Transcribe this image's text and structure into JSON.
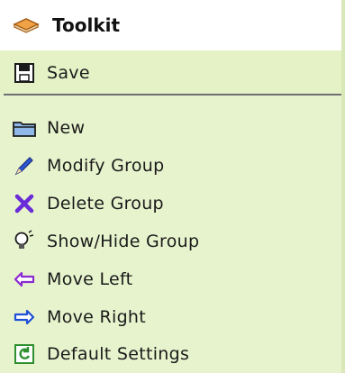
{
  "header": {
    "title": "Toolkit",
    "icon": "book-icon"
  },
  "items_top": [
    {
      "label": "Save",
      "icon": "floppy-disk-icon"
    }
  ],
  "items": [
    {
      "label": "New",
      "icon": "folder-icon"
    },
    {
      "label": "Modify Group",
      "icon": "pencil-icon"
    },
    {
      "label": "Delete Group",
      "icon": "delete-x-icon"
    },
    {
      "label": "Show/Hide Group",
      "icon": "lightbulb-icon"
    },
    {
      "label": "Move Left",
      "icon": "arrow-left-icon"
    },
    {
      "label": "Move Right",
      "icon": "arrow-right-icon"
    },
    {
      "label": "Default Settings",
      "icon": "refresh-icon"
    }
  ],
  "colors": {
    "panel_bg": "#e7f3cd",
    "header_bg": "#ffffff",
    "divider": "#6f6f6f",
    "delete_icon": "#6a2bd8",
    "arrow_left_icon": "#8b2ad0",
    "arrow_right_icon": "#1f4fd6",
    "refresh_icon": "#2f8f2f"
  }
}
